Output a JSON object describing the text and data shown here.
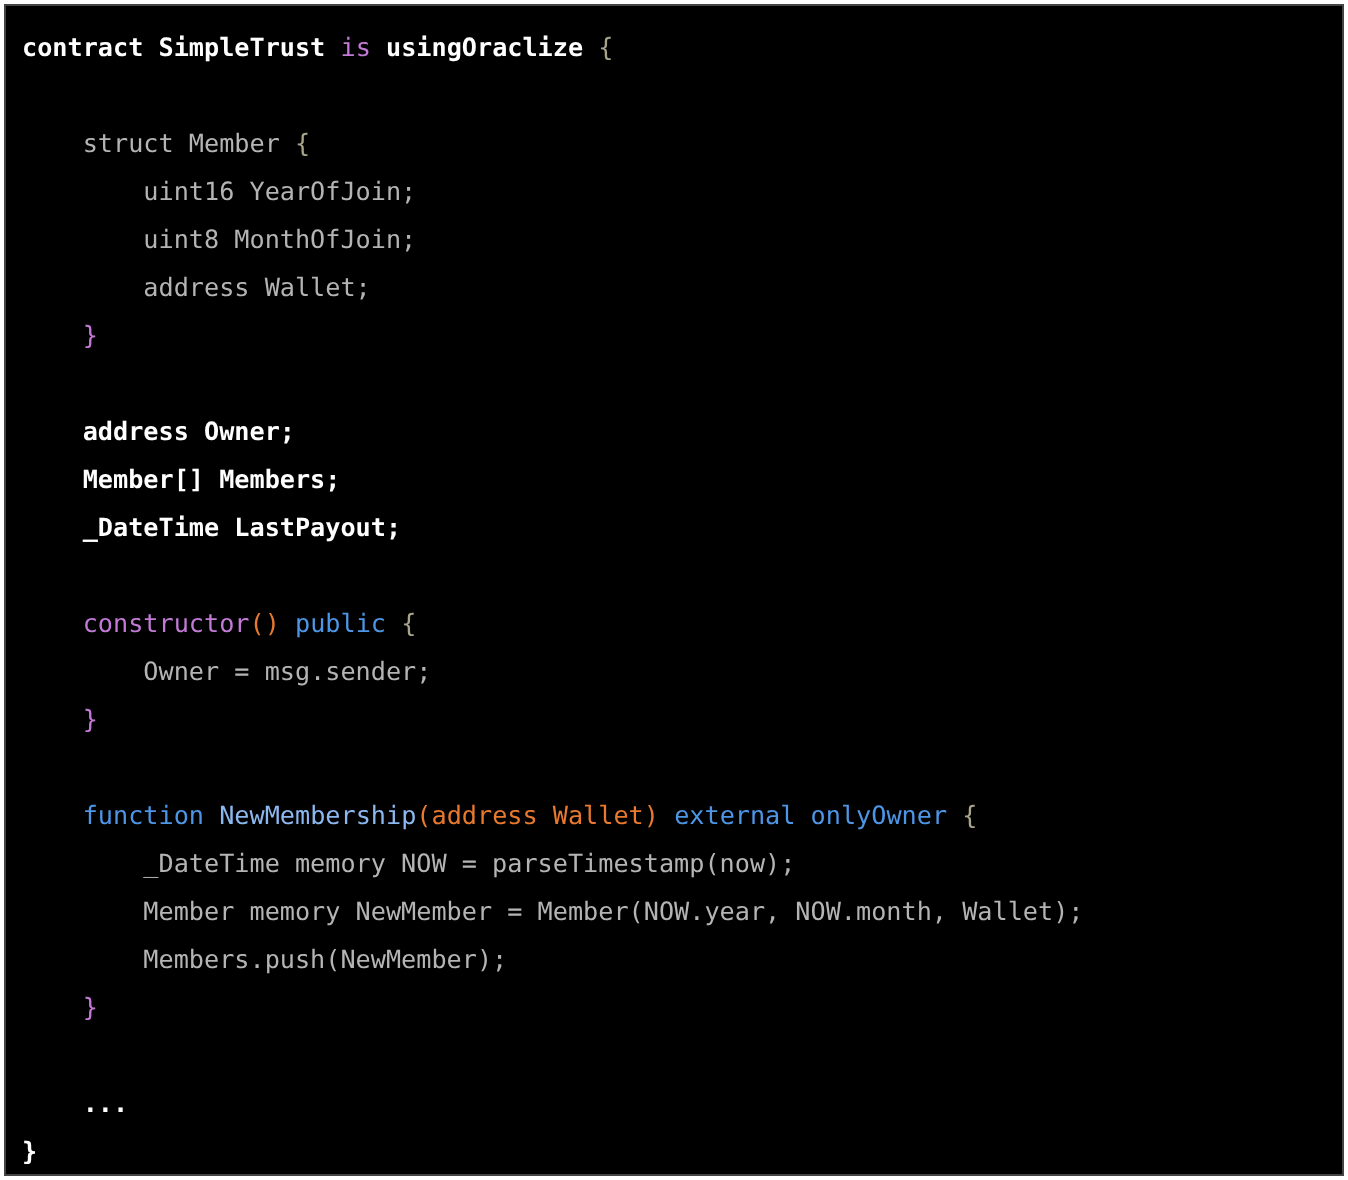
{
  "code_block": {
    "lines": [
      {
        "kind": "code",
        "tokens": [
          {
            "text": "contract SimpleTrust ",
            "kind": "plain"
          },
          {
            "text": "is",
            "kind": "keyword"
          },
          {
            "text": " usingOraclize ",
            "kind": "plain"
          },
          {
            "text": "{",
            "kind": "brace"
          }
        ]
      },
      {
        "kind": "blank"
      },
      {
        "kind": "code",
        "tokens": [
          {
            "text": "    struct Member ",
            "kind": "muted"
          },
          {
            "text": "{",
            "kind": "brace"
          }
        ]
      },
      {
        "kind": "code",
        "tokens": [
          {
            "text": "        uint16 YearOfJoin;",
            "kind": "muted"
          }
        ]
      },
      {
        "kind": "code",
        "tokens": [
          {
            "text": "        uint8 MonthOfJoin;",
            "kind": "muted"
          }
        ]
      },
      {
        "kind": "code",
        "tokens": [
          {
            "text": "        address Wallet;",
            "kind": "muted"
          }
        ]
      },
      {
        "kind": "code",
        "tokens": [
          {
            "text": "    }",
            "kind": "keyword"
          }
        ]
      },
      {
        "kind": "blank"
      },
      {
        "kind": "code",
        "tokens": [
          {
            "text": "    address Owner;",
            "kind": "plain"
          }
        ]
      },
      {
        "kind": "code",
        "tokens": [
          {
            "text": "    Member[] Members;",
            "kind": "plain"
          }
        ]
      },
      {
        "kind": "code",
        "tokens": [
          {
            "text": "    _DateTime LastPayout;",
            "kind": "plain"
          }
        ]
      },
      {
        "kind": "blank"
      },
      {
        "kind": "code",
        "tokens": [
          {
            "text": "    constructor",
            "kind": "keyword"
          },
          {
            "text": "()",
            "kind": "param"
          },
          {
            "text": " public ",
            "kind": "type"
          },
          {
            "text": "{",
            "kind": "brace"
          }
        ]
      },
      {
        "kind": "code",
        "tokens": [
          {
            "text": "        Owner = msg.sender;",
            "kind": "muted"
          }
        ]
      },
      {
        "kind": "code",
        "tokens": [
          {
            "text": "    }",
            "kind": "keyword"
          }
        ]
      },
      {
        "kind": "blank"
      },
      {
        "kind": "code",
        "tokens": [
          {
            "text": "    function ",
            "kind": "type"
          },
          {
            "text": "NewMembership",
            "kind": "name"
          },
          {
            "text": "(address Wallet)",
            "kind": "param"
          },
          {
            "text": " external onlyOwner ",
            "kind": "type"
          },
          {
            "text": "{",
            "kind": "brace"
          }
        ]
      },
      {
        "kind": "code",
        "tokens": [
          {
            "text": "        _DateTime memory NOW = parseTimestamp(now);",
            "kind": "muted"
          }
        ]
      },
      {
        "kind": "code",
        "tokens": [
          {
            "text": "        Member memory NewMember = Member(NOW.year, NOW.month, Wallet);",
            "kind": "muted"
          }
        ]
      },
      {
        "kind": "code",
        "tokens": [
          {
            "text": "        Members.push(NewMember);",
            "kind": "muted"
          }
        ]
      },
      {
        "kind": "code",
        "tokens": [
          {
            "text": "    }",
            "kind": "keyword"
          }
        ]
      },
      {
        "kind": "blank"
      },
      {
        "kind": "code",
        "tokens": [
          {
            "text": "    ...",
            "kind": "plain"
          }
        ]
      },
      {
        "kind": "code",
        "tokens": [
          {
            "text": "}",
            "kind": "plain"
          }
        ]
      }
    ]
  }
}
